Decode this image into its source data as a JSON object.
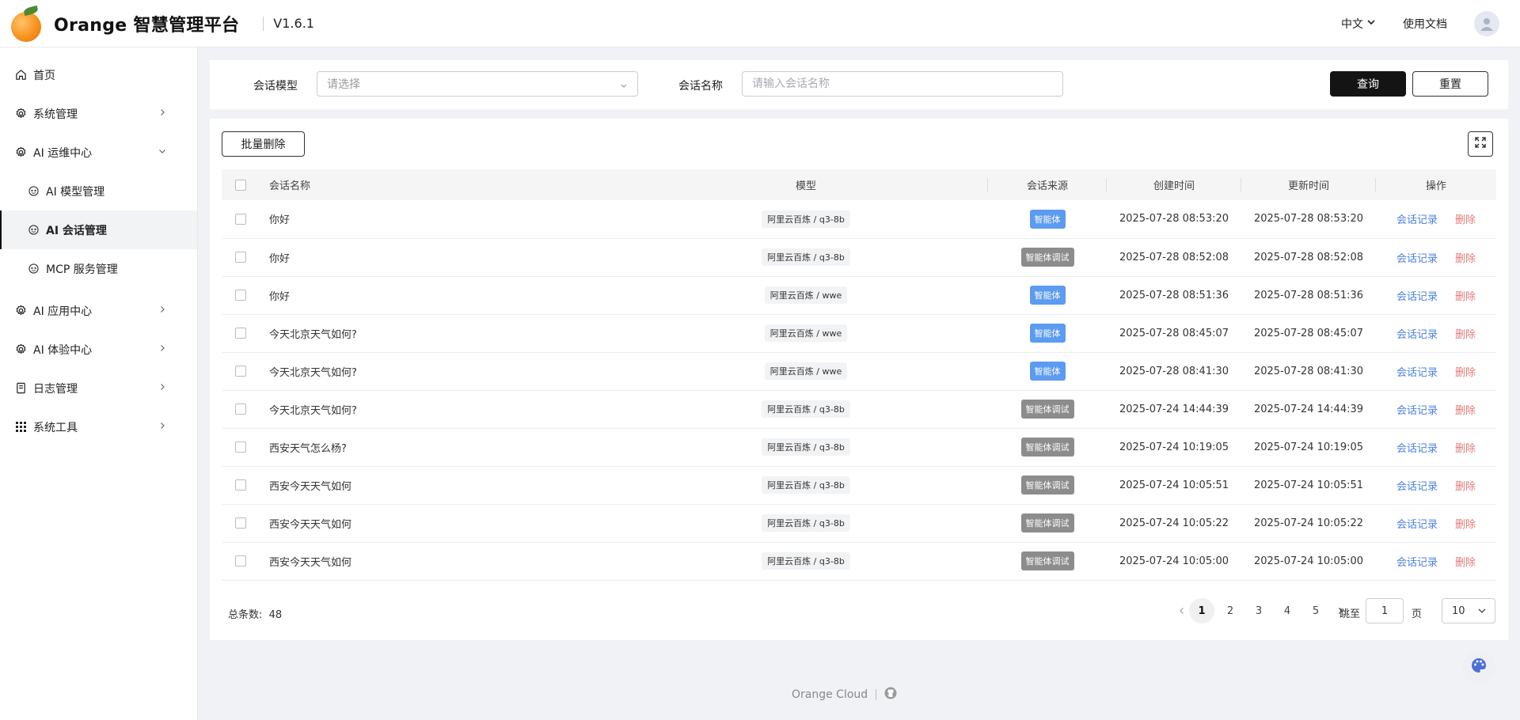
{
  "header": {
    "title": "Orange 智慧管理平台",
    "version": "V1.6.1",
    "language": "中文",
    "docs": "使用文档"
  },
  "sidebar": {
    "items": [
      {
        "label": "首页",
        "icon": "home-icon",
        "expandable": false
      },
      {
        "label": "系统管理",
        "icon": "gear-icon",
        "expandable": true
      },
      {
        "label": "AI 运维中心",
        "icon": "gear-icon",
        "expandable": true,
        "expanded": true
      },
      {
        "label": "AI 模型管理",
        "icon": "robot-icon",
        "sub": true
      },
      {
        "label": "AI 会话管理",
        "icon": "robot-icon",
        "sub": true,
        "active": true
      },
      {
        "label": "MCP 服务管理",
        "icon": "robot-icon",
        "sub": true
      },
      {
        "label": "AI 应用中心",
        "icon": "gear-icon",
        "expandable": true
      },
      {
        "label": "AI 体验中心",
        "icon": "gear-icon",
        "expandable": true
      },
      {
        "label": "日志管理",
        "icon": "document-icon",
        "expandable": true
      },
      {
        "label": "系统工具",
        "icon": "grid-icon",
        "expandable": true
      }
    ]
  },
  "search": {
    "model_label": "会话模型",
    "model_placeholder": "请选择",
    "name_label": "会话名称",
    "name_placeholder": "请输入会话名称",
    "query_button": "查询",
    "reset_button": "重置"
  },
  "toolbar": {
    "batch_delete": "批量删除"
  },
  "table": {
    "columns": [
      "会话名称",
      "模型",
      "会话来源",
      "创建时间",
      "更新时间",
      "操作"
    ],
    "rows": [
      {
        "name": "你好",
        "model": "阿里云百炼 / q3-8b",
        "source": "智能体",
        "created": "2025-07-28 08:53:20",
        "updated": "2025-07-28 08:53:20"
      },
      {
        "name": "你好",
        "model": "阿里云百炼 / q3-8b",
        "source": "智能体调试",
        "created": "2025-07-28 08:52:08",
        "updated": "2025-07-28 08:52:08"
      },
      {
        "name": "你好",
        "model": "阿里云百炼 / wwe",
        "source": "智能体",
        "created": "2025-07-28 08:51:36",
        "updated": "2025-07-28 08:51:36"
      },
      {
        "name": "今天北京天气如何?",
        "model": "阿里云百炼 / wwe",
        "source": "智能体",
        "created": "2025-07-28 08:45:07",
        "updated": "2025-07-28 08:45:07"
      },
      {
        "name": "今天北京天气如何?",
        "model": "阿里云百炼 / wwe",
        "source": "智能体",
        "created": "2025-07-28 08:41:30",
        "updated": "2025-07-28 08:41:30"
      },
      {
        "name": "今天北京天气如何?",
        "model": "阿里云百炼 / q3-8b",
        "source": "智能体调试",
        "created": "2025-07-24 14:44:39",
        "updated": "2025-07-24 14:44:39"
      },
      {
        "name": "西安天气怎么杨?",
        "model": "阿里云百炼 / q3-8b",
        "source": "智能体调试",
        "created": "2025-07-24 10:19:05",
        "updated": "2025-07-24 10:19:05"
      },
      {
        "name": "西安今天天气如何",
        "model": "阿里云百炼 / q3-8b",
        "source": "智能体调试",
        "created": "2025-07-24 10:05:51",
        "updated": "2025-07-24 10:05:51"
      },
      {
        "name": "西安今天天气如何",
        "model": "阿里云百炼 / q3-8b",
        "source": "智能体调试",
        "created": "2025-07-24 10:05:22",
        "updated": "2025-07-24 10:05:22"
      },
      {
        "name": "西安今天天气如何",
        "model": "阿里云百炼 / q3-8b",
        "source": "智能体调试",
        "created": "2025-07-24 10:05:00",
        "updated": "2025-07-24 10:05:00"
      }
    ],
    "action_record": "会话记录",
    "action_delete": "删除"
  },
  "source_colors": {
    "智能体": "#5b9bf0",
    "智能体调试": "#8c8c8c"
  },
  "pagination": {
    "total_label": "总条数:",
    "total": "48",
    "pages": [
      "1",
      "2",
      "3",
      "4",
      "5"
    ],
    "current": "1",
    "jump_label": "跳至",
    "jump_value": "1",
    "page_unit": "页",
    "page_size": "10"
  },
  "footer": {
    "brand": "Orange Cloud"
  }
}
